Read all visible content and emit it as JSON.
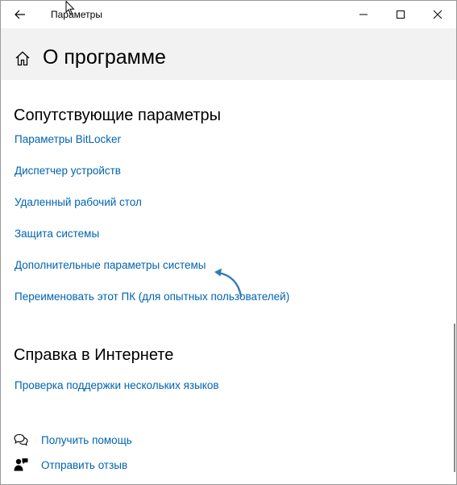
{
  "window": {
    "title": "Параметры"
  },
  "header": {
    "title": "О программе"
  },
  "related": {
    "heading": "Сопутствующие параметры",
    "links": [
      "Параметры BitLocker",
      "Диспетчер устройств",
      "Удаленный рабочий стол",
      "Защита системы",
      "Дополнительные параметры системы",
      "Переименовать этот ПК (для опытных пользователей)"
    ]
  },
  "online_help": {
    "heading": "Справка в Интернете",
    "links": [
      "Проверка поддержки нескольких языков"
    ]
  },
  "footer": {
    "get_help": "Получить помощь",
    "feedback": "Отправить отзыв"
  },
  "colors": {
    "link": "#0063b1",
    "header_bg": "#f2f2f2",
    "annotation_arrow": "#2e7cb8"
  },
  "icons": {
    "back": "back-arrow-icon",
    "minimize": "minimize-icon",
    "maximize": "maximize-icon",
    "close": "close-icon",
    "home": "home-icon",
    "help": "chat-help-icon",
    "feedback": "feedback-person-icon"
  }
}
